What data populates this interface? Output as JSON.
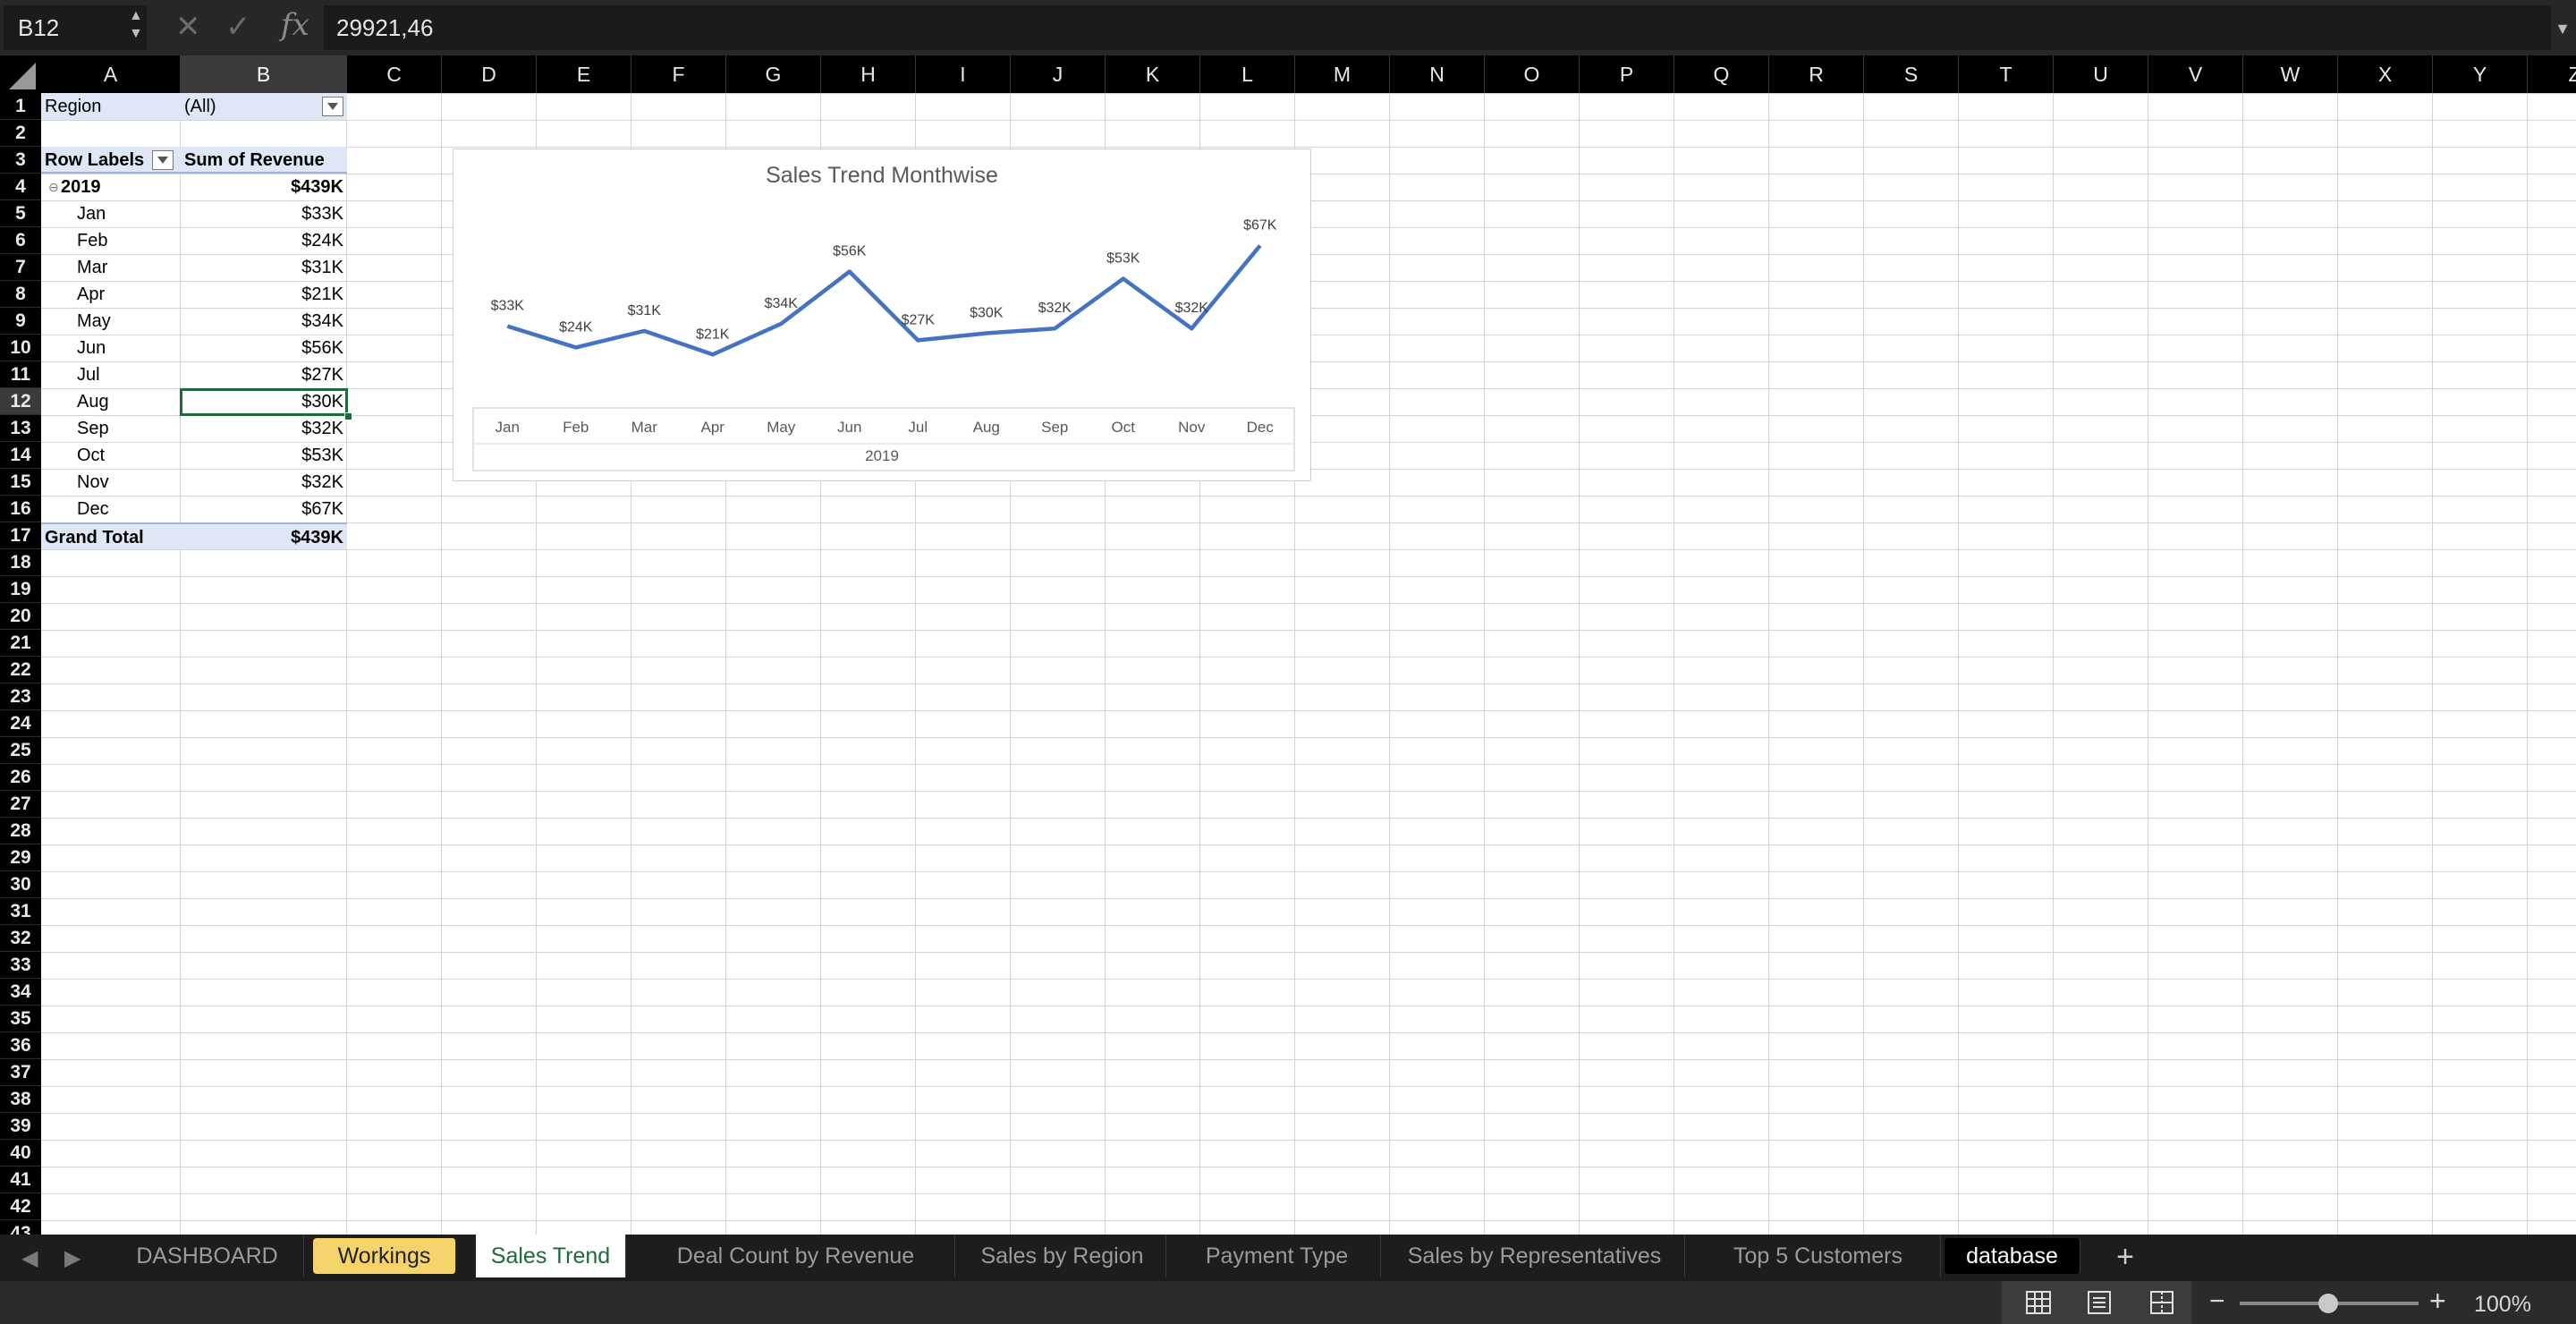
{
  "formula_bar": {
    "name_box": "B12",
    "cancel_icon": "close-icon",
    "enter_icon": "check-icon",
    "fx_label": "fx",
    "formula": "29921,46"
  },
  "columns": [
    "A",
    "B",
    "C",
    "D",
    "E",
    "F",
    "G",
    "H",
    "I",
    "J",
    "K",
    "L",
    "M",
    "N",
    "O",
    "P",
    "Q",
    "R",
    "S",
    "T",
    "U",
    "V",
    "W",
    "X",
    "Y",
    "Z"
  ],
  "selected_column": "B",
  "rows": [
    "1",
    "2",
    "3",
    "4",
    "5",
    "6",
    "7",
    "8",
    "9",
    "10",
    "11",
    "12",
    "13",
    "14",
    "15",
    "16",
    "17",
    "18",
    "19",
    "20",
    "21",
    "22",
    "23",
    "24",
    "25",
    "26",
    "27",
    "28",
    "29",
    "30",
    "31",
    "32",
    "33",
    "34",
    "35",
    "36",
    "37",
    "38",
    "39",
    "40",
    "41",
    "42",
    "43"
  ],
  "selected_row": "12",
  "pivot": {
    "filter_label": "Region",
    "filter_value": "(All)",
    "row_labels_header": "Row Labels",
    "value_header": "Sum of Revenue",
    "year_label": "2019",
    "year_total": "$439K",
    "months": [
      {
        "label": "Jan",
        "value": "$33K"
      },
      {
        "label": "Feb",
        "value": "$24K"
      },
      {
        "label": "Mar",
        "value": "$31K"
      },
      {
        "label": "Apr",
        "value": "$21K"
      },
      {
        "label": "May",
        "value": "$34K"
      },
      {
        "label": "Jun",
        "value": "$56K"
      },
      {
        "label": "Jul",
        "value": "$27K"
      },
      {
        "label": "Aug",
        "value": "$30K"
      },
      {
        "label": "Sep",
        "value": "$32K"
      },
      {
        "label": "Oct",
        "value": "$53K"
      },
      {
        "label": "Nov",
        "value": "$32K"
      },
      {
        "label": "Dec",
        "value": "$67K"
      }
    ],
    "grand_total_label": "Grand Total",
    "grand_total_value": "$439K"
  },
  "chart_data": {
    "type": "line",
    "title": "Sales Trend Monthwise",
    "categories": [
      "Jan",
      "Feb",
      "Mar",
      "Apr",
      "May",
      "Jun",
      "Jul",
      "Aug",
      "Sep",
      "Oct",
      "Nov",
      "Dec"
    ],
    "category_group": "2019",
    "values": [
      33,
      24,
      31,
      21,
      34,
      56,
      27,
      30,
      32,
      53,
      32,
      67
    ],
    "data_labels": [
      "$33K",
      "$24K",
      "$31K",
      "$21K",
      "$34K",
      "$56K",
      "$27K",
      "$30K",
      "$32K",
      "$53K",
      "$32K",
      "$67K"
    ],
    "series": [
      {
        "values": [
          33,
          24,
          31,
          21,
          34,
          56,
          27,
          30,
          32,
          53,
          32,
          67
        ]
      }
    ],
    "line_color": "#4472c4",
    "grid": false,
    "legend": "none"
  },
  "sheet_tabs": [
    {
      "label": "DASHBOARD",
      "style": "normal"
    },
    {
      "label": "Workings",
      "style": "yellow"
    },
    {
      "label": "Sales Trend",
      "style": "active"
    },
    {
      "label": "Deal Count by Revenue",
      "style": "normal"
    },
    {
      "label": "Sales by Region",
      "style": "normal"
    },
    {
      "label": "Payment Type",
      "style": "normal"
    },
    {
      "label": "Sales by Representatives",
      "style": "normal"
    },
    {
      "label": "Top 5 Customers",
      "style": "normal"
    },
    {
      "label": "database",
      "style": "black"
    }
  ],
  "add_sheet": "+",
  "status_bar": {
    "zoom": "100%",
    "view_icons": [
      "normal-view-icon",
      "page-layout-icon",
      "page-break-icon"
    ]
  },
  "colors": {
    "accent_green": "#1e6b3a",
    "pivot_header": "#dfe6f5",
    "tab_yellow": "#f4d36b"
  }
}
